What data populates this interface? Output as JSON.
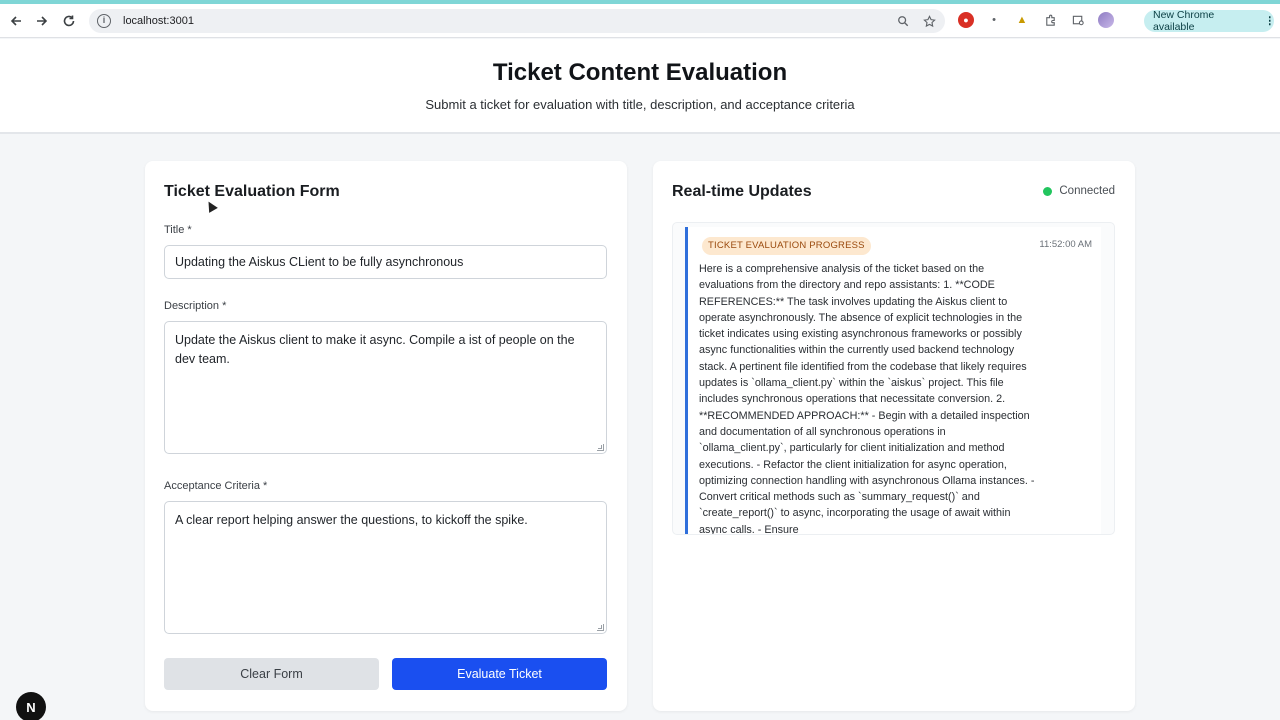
{
  "browser": {
    "url": "localhost:3001",
    "update_label": "New Chrome available",
    "update_menu": "⋮"
  },
  "header": {
    "title": "Ticket Content Evaluation",
    "subtitle": "Submit a ticket for evaluation with title, description, and acceptance criteria"
  },
  "form": {
    "title": "Ticket Evaluation Form",
    "title_label": "Title *",
    "title_value": "Updating the Aiskus CLient to be fully asynchronous",
    "description_label": "Description *",
    "description_value": "Update the Aiskus client to make it async. Compile a  ist of people on the dev team.",
    "criteria_label": "Acceptance Criteria *",
    "criteria_value": "A clear report helping answer the questions, to kickoff the spike.",
    "clear_label": "Clear Form",
    "submit_label": "Evaluate Ticket"
  },
  "updates": {
    "title": "Real-time Updates",
    "status": "Connected",
    "items": [
      {
        "badge": "TICKET EVALUATION PROGRESS",
        "time": "11:52:00 AM",
        "text": "Here is a comprehensive analysis of the ticket based on the evaluations from the directory and repo assistants: 1. **CODE REFERENCES:** The task involves updating the Aiskus client to operate asynchronously. The absence of explicit technologies in the ticket indicates using existing asynchronous frameworks or possibly async functionalities within the currently used backend technology stack. A pertinent file identified from the codebase that likely requires updates is `ollama_client.py` within the `aiskus` project. This file includes synchronous operations that necessitate conversion. 2. **RECOMMENDED APPROACH:** - Begin with a detailed inspection and documentation of all synchronous operations in `ollama_client.py`, particularly for client initialization and method executions. - Refactor the client initialization for async operation, optimizing connection handling with asynchronous Ollama instances. - Convert critical methods such as `summary_request()` and `create_report()` to async, incorporating the usage of await within async calls. - Ensure"
      }
    ]
  },
  "dev_badge": "N",
  "colors": {
    "primary_button": "#1a4ff0",
    "status_connected": "#22c55e",
    "badge_bg": "#fde8cf",
    "accent_bar": "#2f6fdb"
  },
  "icons": [
    "back-icon",
    "forward-icon",
    "reload-icon",
    "site-info-icon",
    "zoom-icon",
    "bookmark-star-icon",
    "extensions-icon",
    "tab-search-icon",
    "profile-avatar"
  ]
}
